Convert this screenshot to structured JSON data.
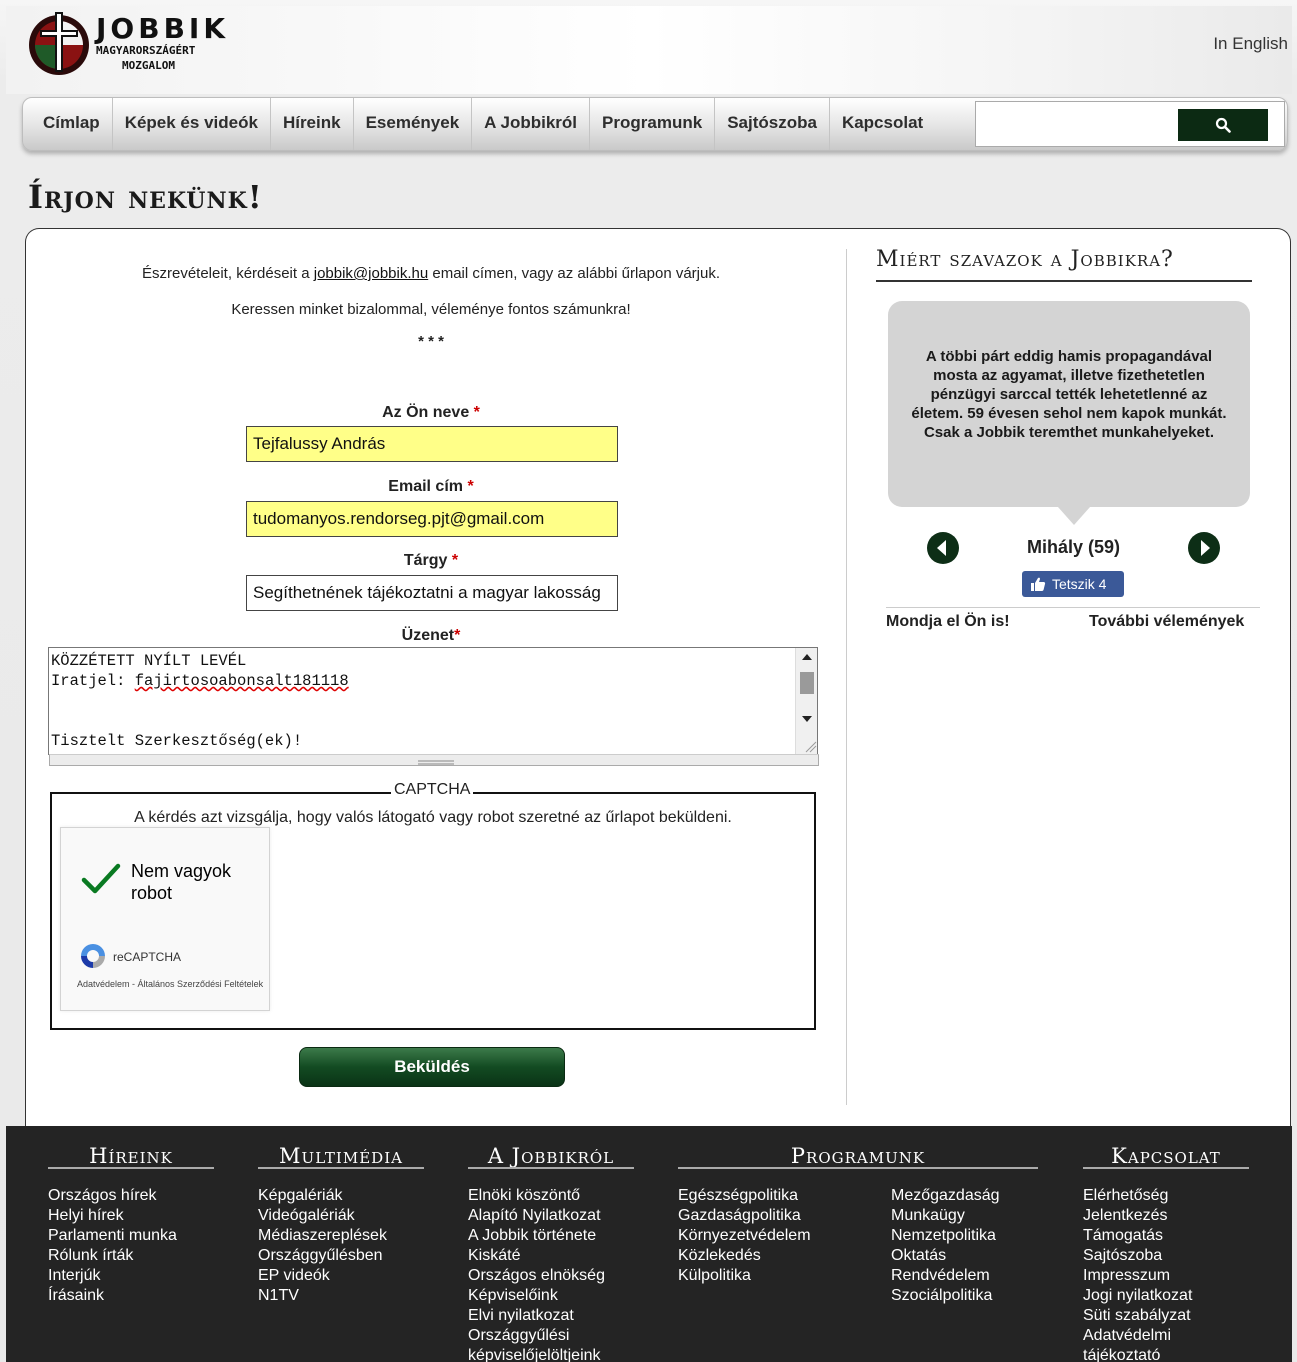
{
  "header": {
    "logo_line1": "JOBBIK",
    "logo_line2": "MAGYARORSZÁGÉRT",
    "logo_line3": "MOZGALOM",
    "lang_link": "In English"
  },
  "nav": {
    "items": [
      "Címlap",
      "Képek és videók",
      "Híreink",
      "Események",
      "A Jobbikról",
      "Programunk",
      "Sajtószoba",
      "Kapcsolat"
    ],
    "search_value": ""
  },
  "page_title": "Írjon nekünk!",
  "form": {
    "intro1_before": "Észrevételeit, kérdéseit a ",
    "intro1_link": "jobbik@jobbik.hu",
    "intro1_after": " email címen, vagy az alábbi űrlapon várjuk.",
    "intro2": "Keressen minket bizalommal, véleménye fontos számunkra!",
    "stars": "* * *",
    "name_label": "Az Ön neve",
    "name_value": "Tejfalussy András",
    "email_label": "Email cím",
    "email_value": "tudomanyos.rendorseg.pjt@gmail.com",
    "subject_label": "Tárgy",
    "subject_value": "Segíthetnének tájékoztatni a magyar lakosság",
    "message_label": "Üzenet",
    "message_line1": "KÖZZÉTETT NYÍLT LEVÉL",
    "message_line2_label": "Iratjel: ",
    "message_line2_value": "fajirtosoabonsalt181118",
    "message_line3": "Tisztelt Szerkesztőség(ek)!",
    "required_mark": "*",
    "captcha_legend": "CAPTCHA",
    "captcha_question": "A kérdés azt vizsgálja, hogy valós látogató vagy robot szeretné az űrlapot beküldeni.",
    "recaptcha_label": "Nem vagyok robot",
    "recaptcha_brand": "reCAPTCHA",
    "recaptcha_terms": "Adatvédelem - Általános Szerződési Feltételek",
    "submit_label": "Beküldés"
  },
  "sidebar": {
    "title": "Miért szavazok a Jobbikra?",
    "quote": "A többi párt eddig hamis propagandával mosta az agyamat, illetve fizethetetlen pénzügyi sarccal tették lehetetlenné az életem. 59 évesen sehol nem kapok munkát. Csak a Jobbik teremthet munkahelyeket.",
    "name": "Mihály (59)",
    "like_label": "Tetszik 4",
    "link_left": "Mondja el Ön is!",
    "link_right": "További vélemények"
  },
  "footer": {
    "hireink": {
      "title": "Híreink",
      "items": [
        "Országos hírek",
        "Helyi hírek",
        "Parlamenti munka",
        "Rólunk írták",
        "Interjúk",
        "Írásaink"
      ]
    },
    "multimedia": {
      "title": "Multimédia",
      "items": [
        "Képgalériák",
        "Videógalériák",
        "Médiaszereplések",
        "Országgyűlésben",
        "EP videók",
        "N1TV"
      ]
    },
    "jobbikrol": {
      "title": "A Jobbikról",
      "items": [
        "Elnöki köszöntő",
        "Alapító Nyilatkozat",
        "A Jobbik története",
        "Kiskáté",
        "Országos elnökség",
        "Képviselőink",
        "Elvi nyilatkozat",
        "Országgyűlési",
        "képviselőjelöltjeink"
      ]
    },
    "programunk": {
      "title": "Programunk",
      "items_left": [
        "Egészségpolitika",
        "Gazdaságpolitika",
        "Környezetvédelem",
        "Közlekedés",
        "Külpolitika"
      ],
      "items_right": [
        "Mezőgazdaság",
        "Munkaügy",
        "Nemzetpolitika",
        "Oktatás",
        "Rendvédelem",
        "Szociálpolitika"
      ]
    },
    "kapcsolat": {
      "title": "Kapcsolat",
      "items": [
        "Elérhetőség",
        "Jelentkezés",
        "Támogatás",
        "Sajtószoba",
        "Impresszum",
        "Jogi nyilatkozat",
        "Süti szabályzat",
        "Adatvédelmi",
        "tájékoztató"
      ]
    }
  }
}
